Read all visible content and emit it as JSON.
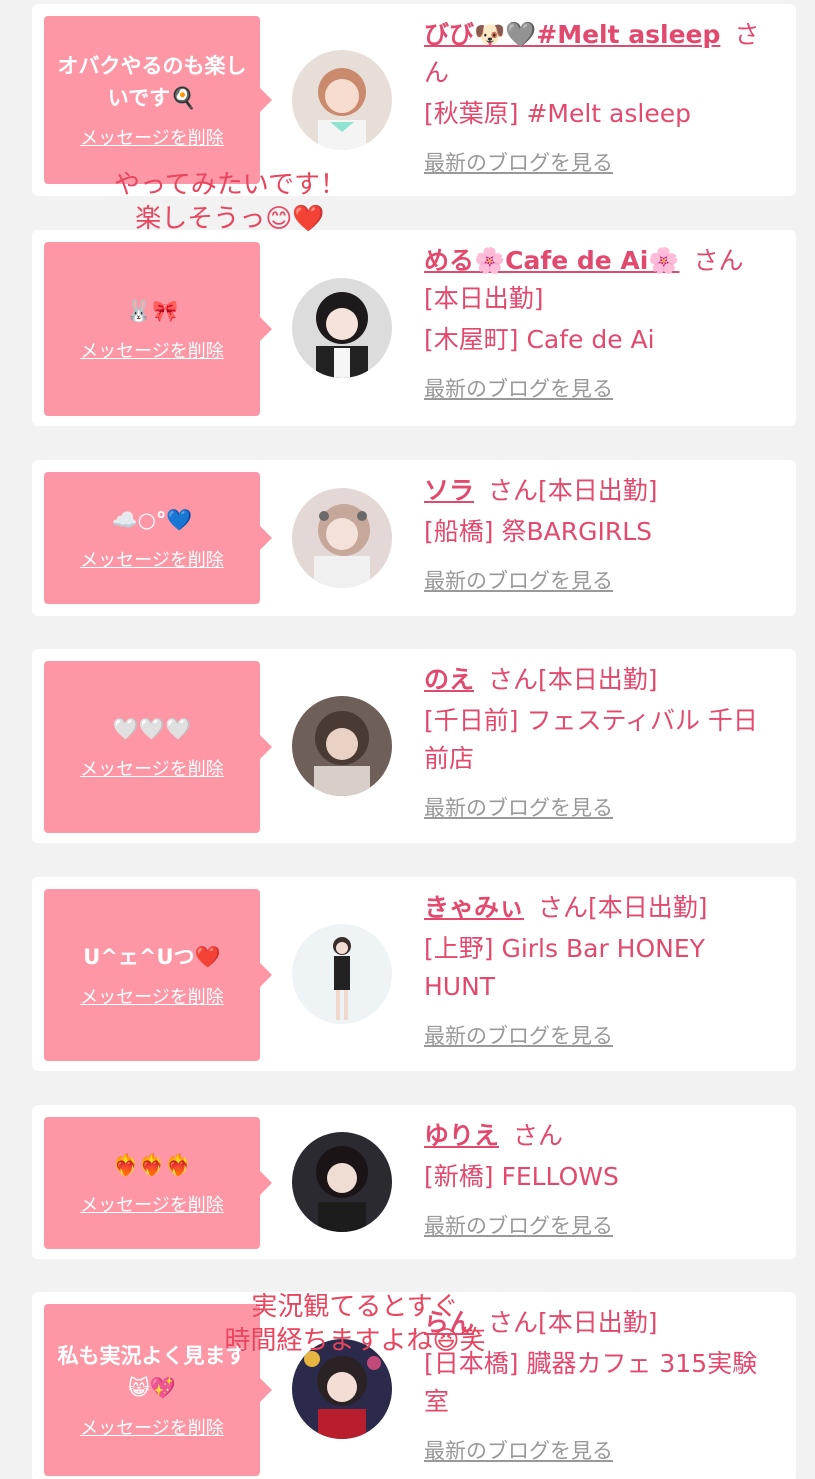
{
  "delete_label": "メッセージを削除",
  "blog_label": "最新のブログを見る",
  "colors": {
    "bubble": "#fe97a5",
    "accent": "#e2496e",
    "muted": "#999999",
    "background": "#f2f2f2"
  },
  "cards": [
    {
      "message": "オバクやるのも楽しいです🍳",
      "name": "びび🐶🩶#Melt asleep",
      "suffix": "さん",
      "shop": "[秋葉原] #Melt asleep",
      "avatar_icon": "avatar-photo"
    },
    {
      "message": "🐰🎀",
      "name": "める🌸Cafe de Ai🌸",
      "suffix": "さん[本日出勤]",
      "shop": "[木屋町] Cafe de Ai",
      "avatar_icon": "avatar-photo"
    },
    {
      "message": "☁️○°💙",
      "name": "ソラ",
      "suffix": "さん[本日出勤]",
      "shop": "[船橋] 祭BARGIRLS",
      "avatar_icon": "avatar-photo"
    },
    {
      "message": "🤍🤍🤍",
      "name": "のえ",
      "suffix": "さん[本日出勤]",
      "shop": "[千日前] フェスティバル 千日前店",
      "avatar_icon": "avatar-photo"
    },
    {
      "message": "U^ェ^Uつ❤️",
      "name": "きゃみぃ",
      "suffix": "さん[本日出勤]",
      "shop": "[上野] Girls Bar HONEY HUNT",
      "avatar_icon": "avatar-photo"
    },
    {
      "message": "❤️‍🔥❤️‍🔥❤️‍🔥",
      "name": "ゆりえ",
      "suffix": "さん",
      "shop": "[新橋] FELLOWS",
      "avatar_icon": "avatar-photo"
    },
    {
      "message": "私も実況よく見ます😸💖",
      "name": "らん",
      "suffix": "さん[本日出勤]",
      "shop": "[日本橋] 臓器カフェ 315実験室",
      "avatar_icon": "avatar-photo"
    }
  ],
  "overlays": [
    {
      "text": "やってみたいです！\n楽しそうっ😊❤️"
    },
    {
      "text": "実況観てるとすぐ\n時間経ちますよね😆笑"
    }
  ]
}
